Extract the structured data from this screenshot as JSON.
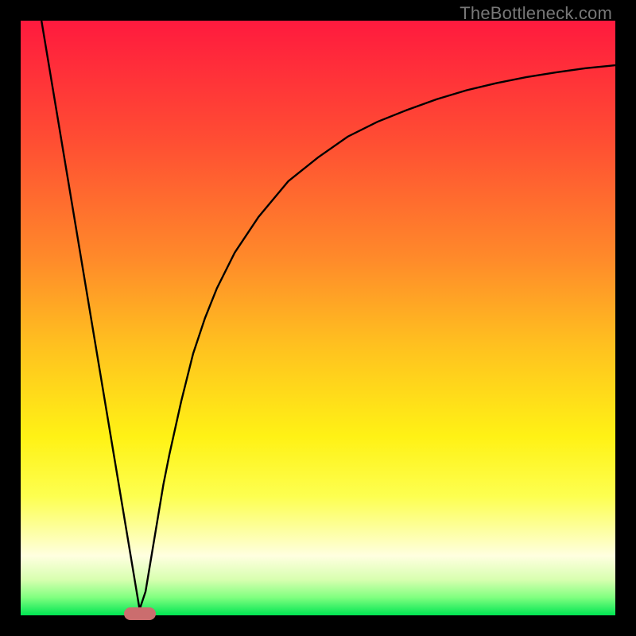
{
  "watermark": "TheBottleneck.com",
  "chart_data": {
    "type": "line",
    "title": "",
    "xlabel": "",
    "ylabel": "",
    "xlim": [
      0,
      100
    ],
    "ylim": [
      0,
      100
    ],
    "grid": false,
    "legend": false,
    "background_gradient": {
      "stops": [
        {
          "pos": 0.0,
          "color": "#ff1a3e"
        },
        {
          "pos": 0.2,
          "color": "#ff4d33"
        },
        {
          "pos": 0.4,
          "color": "#ff8a2a"
        },
        {
          "pos": 0.55,
          "color": "#ffc21f"
        },
        {
          "pos": 0.7,
          "color": "#fff215"
        },
        {
          "pos": 0.8,
          "color": "#fdff50"
        },
        {
          "pos": 0.86,
          "color": "#fdffa5"
        },
        {
          "pos": 0.9,
          "color": "#ffffe0"
        },
        {
          "pos": 0.94,
          "color": "#d8ffb0"
        },
        {
          "pos": 0.97,
          "color": "#80ff80"
        },
        {
          "pos": 1.0,
          "color": "#00e552"
        }
      ]
    },
    "series": [
      {
        "name": "bottleneck-curve",
        "color": "#000000",
        "x": [
          3.5,
          5,
          7.5,
          10,
          12.5,
          15,
          17,
          18.5,
          19.5,
          20,
          21,
          22,
          23,
          24,
          25,
          27,
          29,
          31,
          33,
          36,
          40,
          45,
          50,
          55,
          60,
          65,
          70,
          75,
          80,
          85,
          90,
          95,
          100
        ],
        "values": [
          100,
          91,
          76,
          61,
          46,
          31,
          19,
          10,
          4,
          1,
          4,
          10,
          16,
          22,
          27,
          36,
          44,
          50,
          55,
          61,
          67,
          73,
          77,
          80.5,
          83,
          85,
          86.8,
          88.3,
          89.5,
          90.5,
          91.3,
          92,
          92.5
        ]
      }
    ],
    "marker": {
      "name": "optimal-point",
      "x": 20,
      "y": 0.3,
      "color": "#cb6d6e"
    }
  }
}
